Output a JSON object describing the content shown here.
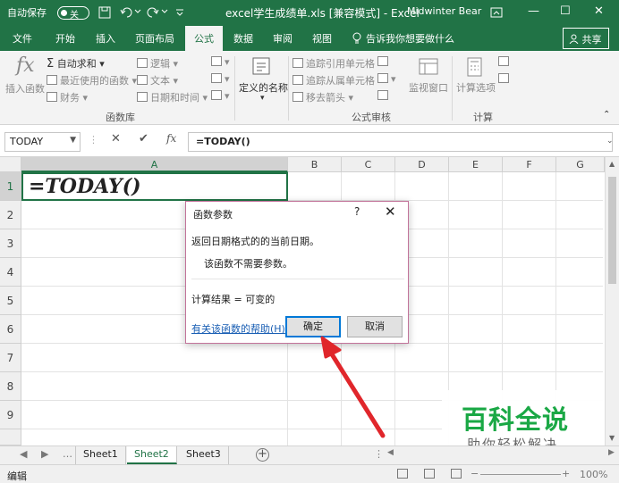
{
  "titlebar": {
    "autosave": "自动保存",
    "toggle": "关",
    "title": "excel学生成绩单.xls  [兼容模式]  -  Excel",
    "user": "Midwinter Bear",
    "min": "—",
    "restore": "☐",
    "close": "✕",
    "restore_small": "⧉"
  },
  "tabs": [
    "文件",
    "开始",
    "插入",
    "页面布局",
    "公式",
    "数据",
    "审阅",
    "视图"
  ],
  "active_tab": "公式",
  "tell_me": "告诉我你想要做什么",
  "share": "共享",
  "ribbon": {
    "insert_function": "插入函数",
    "autosum": "自动求和",
    "recent": "最近使用的函数",
    "finance": "财务",
    "logical": "逻辑",
    "text": "文本",
    "datetime": "日期和时间",
    "defined_name": "定义的名称",
    "trace_prec": "追踪引用单元格",
    "trace_dep": "追踪从属单元格",
    "remove_arrows": "移去箭头",
    "watch": "监视窗口",
    "calc_options": "计算选项",
    "group_library": "函数库",
    "group_audit": "公式审核",
    "group_calc": "计算"
  },
  "formula_bar": {
    "name_box": "TODAY",
    "cancel": "✕",
    "enter": "✔",
    "fx": "fx",
    "formula": "=TODAY()"
  },
  "grid": {
    "columns": [
      "A",
      "B",
      "C",
      "D",
      "E",
      "F",
      "G"
    ],
    "rows": [
      "1",
      "2",
      "3",
      "4",
      "5",
      "6",
      "7",
      "8",
      "9"
    ],
    "a1": "=TODAY()"
  },
  "dialog": {
    "title": "函数参数",
    "help": "?",
    "close": "✕",
    "desc": "返回日期格式的的当前日期。",
    "noargs": "该函数不需要参数。",
    "result": "计算结果 =   可变的",
    "help_link": "有关该函数的帮助(H)",
    "ok": "确定",
    "cancel": "取消"
  },
  "watermark": {
    "big": "百科全说",
    "small": "助你轻松解决"
  },
  "sheets": [
    "Sheet1",
    "Sheet2",
    "Sheet3"
  ],
  "active_sheet": "Sheet2",
  "status": {
    "ready": "编辑",
    "zoom": "100%"
  }
}
